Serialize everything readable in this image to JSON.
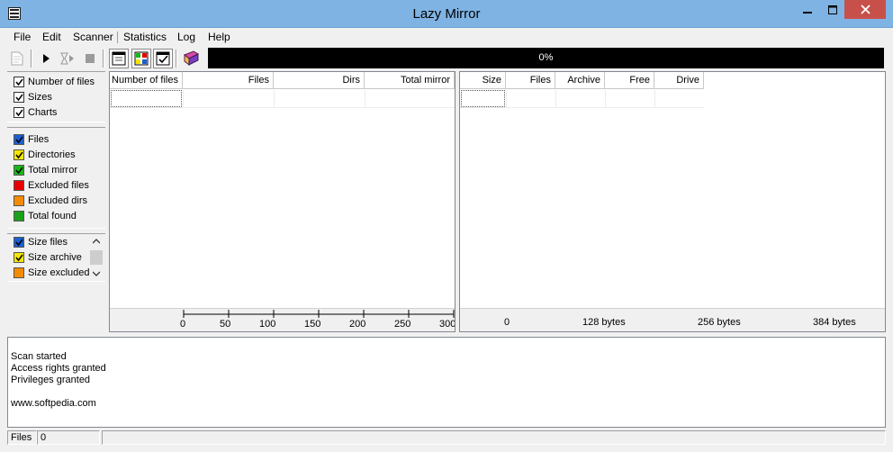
{
  "window": {
    "title": "Lazy Mirror"
  },
  "menu": {
    "items": [
      "File",
      "Edit",
      "Scanner",
      "Statistics",
      "Log",
      "Help"
    ]
  },
  "toolbar": {
    "progress": "0%",
    "progress_value": 0
  },
  "left_panel": {
    "group1": [
      {
        "label": "Number of files",
        "checked": true
      },
      {
        "label": "Sizes",
        "checked": true
      },
      {
        "label": "Charts",
        "checked": true
      }
    ],
    "group2": [
      {
        "label": "Files",
        "checked": true,
        "color": "#1a5fd0"
      },
      {
        "label": "Directories",
        "checked": true,
        "color": "#f5e600"
      },
      {
        "label": "Total mirror",
        "checked": true,
        "color": "#18b818"
      },
      {
        "label": "Excluded files",
        "checked": false,
        "color": "#e60000"
      },
      {
        "label": "Excluded dirs",
        "checked": false,
        "color": "#f58b00"
      },
      {
        "label": "Total found",
        "checked": false,
        "color": "#1aa01a"
      }
    ],
    "group3": [
      {
        "label": "Size files",
        "checked": true,
        "color": "#1a5fd0"
      },
      {
        "label": "Size archive",
        "checked": true,
        "color": "#f5e600"
      },
      {
        "label": "Size excluded",
        "checked": false,
        "color": "#f58b00"
      }
    ]
  },
  "files_list": {
    "columns": [
      "Number of files",
      "Files",
      "Dirs",
      "Total mirror"
    ],
    "axis_ticks": [
      "0",
      "50",
      "100",
      "150",
      "200",
      "250",
      "300"
    ]
  },
  "sizes_list": {
    "columns": [
      "Size",
      "Files",
      "Archive",
      "Free",
      "Drive"
    ],
    "axis_ticks": [
      "0",
      "128 bytes",
      "256 bytes",
      "384 bytes"
    ]
  },
  "log": {
    "lines": [
      "Scan started",
      "Access rights granted",
      "Privileges granted",
      "",
      "www.softpedia.com"
    ]
  },
  "status": {
    "label": "Files",
    "value": "0"
  }
}
